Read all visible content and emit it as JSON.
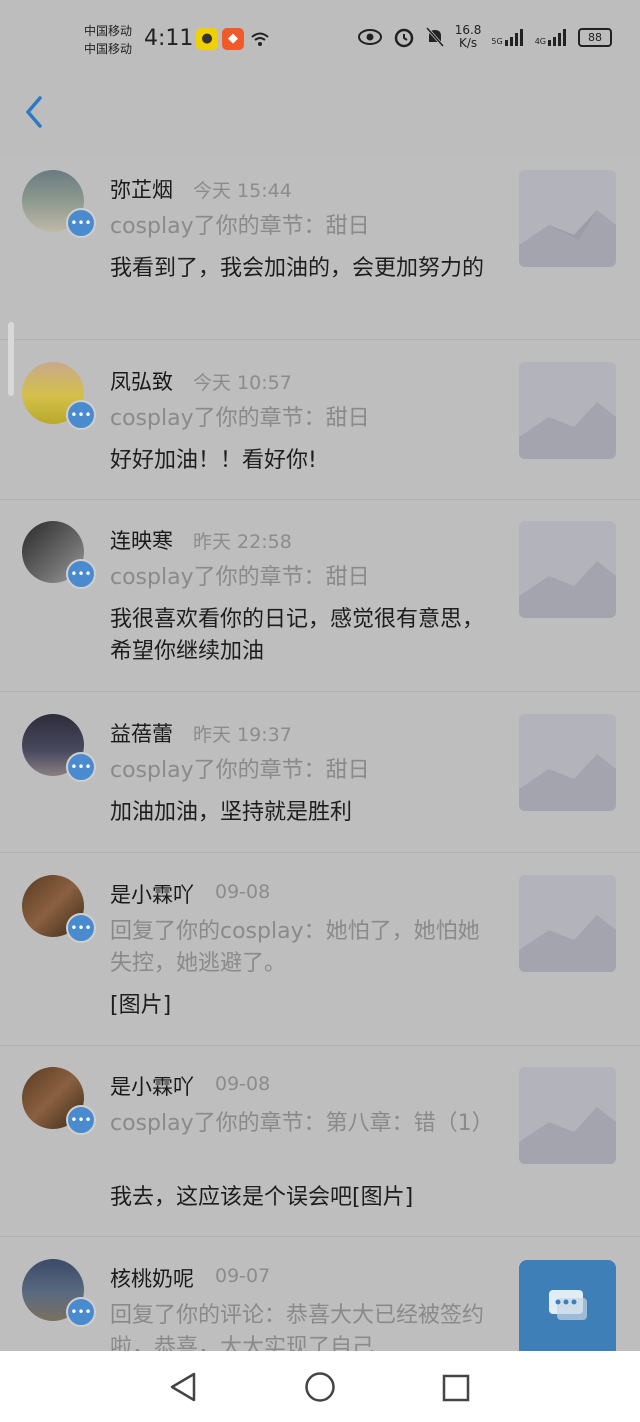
{
  "status_bar": {
    "carrier1": "中国移动",
    "carrier2": "中国移动",
    "time": "4:11",
    "speed_value": "16.8",
    "speed_unit": "K/s",
    "net1": "5G",
    "net2": "4G",
    "battery": "88"
  },
  "icons": {
    "back": "chevron-left-icon",
    "badge": "chat-bubble-icon",
    "thumb": "landscape-placeholder-icon",
    "fab": "chat-icon",
    "nav_back": "triangle-back-icon",
    "nav_home": "circle-home-icon",
    "nav_recent": "square-recent-icon"
  },
  "colors": {
    "accent": "#2f78c4",
    "badge": "#4a8bcf",
    "fab": "#3e7fb8"
  },
  "messages": [
    {
      "name": "弥芷烟",
      "time": "今天 15:44",
      "action": "cosplay了你的章节：甜日",
      "content": "我看到了，我会加油的，会更加努力的"
    },
    {
      "name": "凤弘致",
      "time": "今天 10:57",
      "action": "cosplay了你的章节：甜日",
      "content": "好好加油！！看好你!"
    },
    {
      "name": "连映寒",
      "time": "昨天 22:58",
      "action": "cosplay了你的章节：甜日",
      "content": "我很喜欢看你的日记，感觉很有意思，希望你继续加油"
    },
    {
      "name": "益蓓蕾",
      "time": "昨天 19:37",
      "action": "cosplay了你的章节：甜日",
      "content": "加油加油，坚持就是胜利"
    },
    {
      "name": "是小霖吖",
      "time": "09-08",
      "action": "回复了你的cosplay：她怕了，她怕她失控，她逃避了。",
      "content": "[图片]"
    },
    {
      "name": "是小霖吖",
      "time": "09-08",
      "action": "cosplay了你的章节：第八章：错（1）",
      "content": "我去，这应该是个误会吧[图片]"
    },
    {
      "name": "核桃奶呢",
      "time": "09-07",
      "action": "回复了你的评论：恭喜大大已经被签约啦，恭喜，大大实现了自己",
      "content": ""
    }
  ]
}
